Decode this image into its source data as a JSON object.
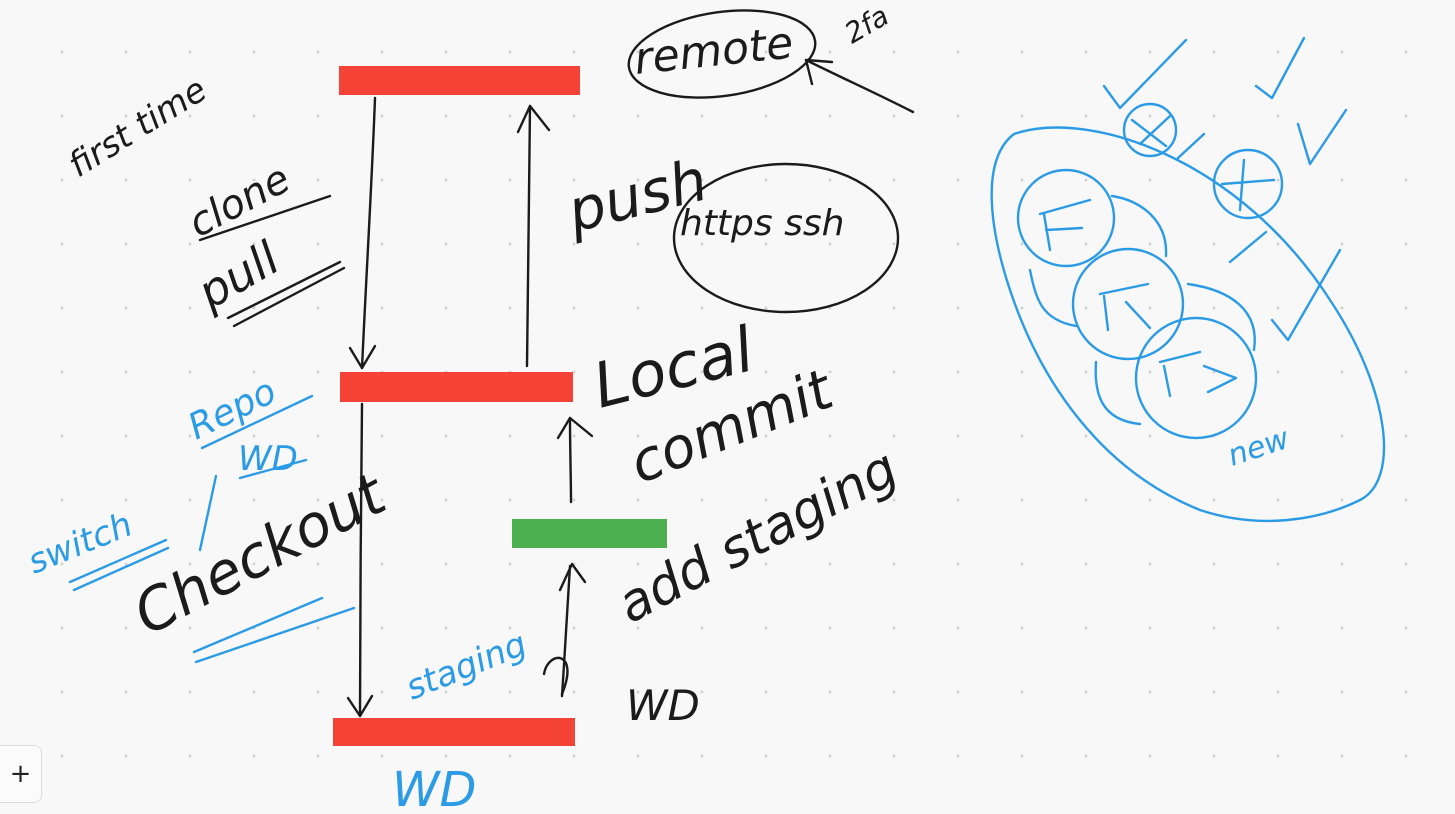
{
  "canvas": {
    "background": "#f8f8f8",
    "dot_color": "#d2d2d2",
    "ink_black": "#1b1b1b",
    "ink_blue": "#2b9be6"
  },
  "nodes": {
    "remote_color": "#f44336",
    "staging_color": "#4caf50"
  },
  "labels": {
    "first_time": "first time",
    "clone": "clone",
    "pull": "pull",
    "push": "push",
    "https_ssh": "https ssh",
    "local": "Local",
    "commit": "commit",
    "add_staging": "add staging",
    "wd": "WD",
    "wd_bottom": "WD",
    "checkout": "Checkout",
    "switch": "switch",
    "repo_to_wd": "Repo",
    "repo_to_wd_sub": "WD",
    "staging": "staging",
    "remote": "remote",
    "two_factor": "2fa",
    "new_label": "new"
  },
  "toolbar": {
    "add_label": "+",
    "add_icon": "plus-icon"
  }
}
